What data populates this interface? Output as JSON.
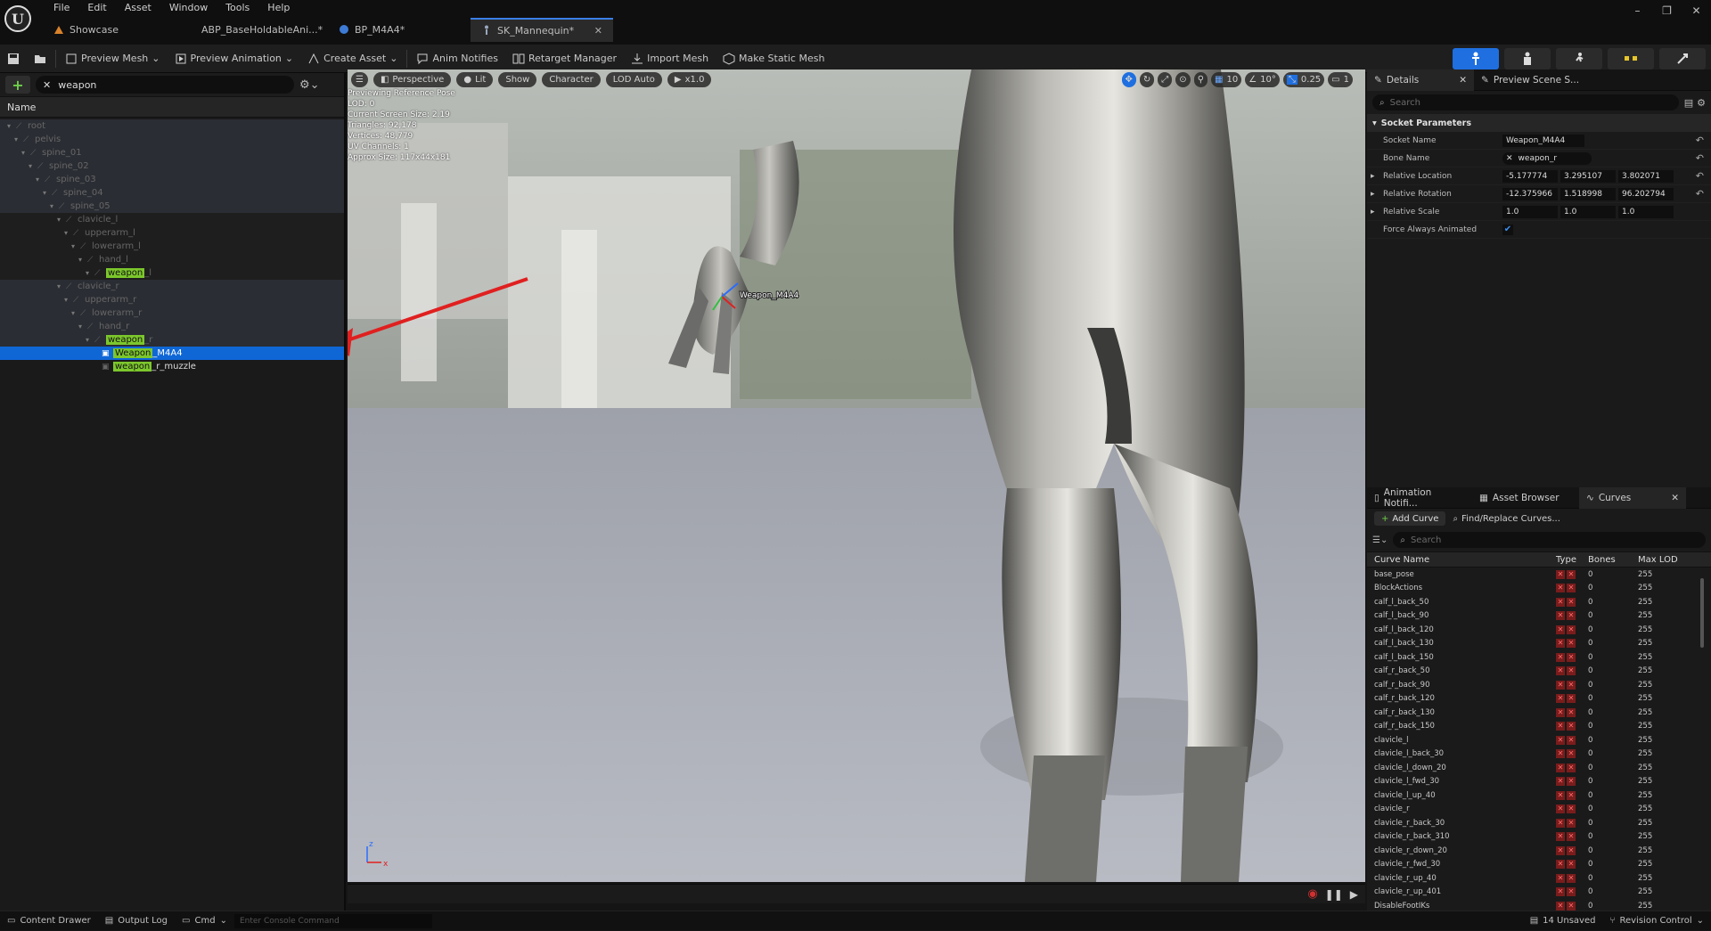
{
  "window": {
    "menu": [
      "File",
      "Edit",
      "Asset",
      "Window",
      "Tools",
      "Help"
    ],
    "tabs": [
      {
        "label": "Showcase",
        "icon": "level-icon"
      },
      {
        "label": "ABP_BaseHoldableAni...*",
        "icon": "anim-blueprint-icon"
      },
      {
        "label": "BP_M4A4*",
        "icon": "blueprint-icon"
      },
      {
        "label": "SK_Mannequin*",
        "icon": "skeleton-icon",
        "active": true
      }
    ]
  },
  "toolbar": {
    "preview_mesh": "Preview Mesh",
    "preview_animation": "Preview Animation",
    "create_asset": "Create Asset",
    "anim_notifies": "Anim Notifies",
    "retarget_manager": "Retarget Manager",
    "import_mesh": "Import Mesh",
    "make_static_mesh": "Make Static Mesh"
  },
  "skeleton_tree": {
    "search_value": "weapon",
    "column_name": "Name",
    "nodes": [
      {
        "label": "root",
        "depth": 0,
        "style": "dim"
      },
      {
        "label": "pelvis",
        "depth": 1,
        "style": "dim"
      },
      {
        "label": "spine_01",
        "depth": 2,
        "style": "dim"
      },
      {
        "label": "spine_02",
        "depth": 3,
        "style": "dim"
      },
      {
        "label": "spine_03",
        "depth": 4,
        "style": "dim"
      },
      {
        "label": "spine_04",
        "depth": 5,
        "style": "dim"
      },
      {
        "label": "spine_05",
        "depth": 6,
        "style": "dim"
      },
      {
        "label": "clavicle_l",
        "depth": 7,
        "style": "mid"
      },
      {
        "label": "upperarm_l",
        "depth": 8,
        "style": "mid"
      },
      {
        "label": "lowerarm_l",
        "depth": 9,
        "style": "mid"
      },
      {
        "label": "hand_l",
        "depth": 10,
        "style": "mid"
      },
      {
        "label": "weapon_l",
        "depth": 11,
        "style": "mid",
        "highlight": "weapon",
        "rest": "_l"
      },
      {
        "label": "clavicle_r",
        "depth": 7,
        "style": "dim"
      },
      {
        "label": "upperarm_r",
        "depth": 8,
        "style": "dim"
      },
      {
        "label": "lowerarm_r",
        "depth": 9,
        "style": "dim"
      },
      {
        "label": "hand_r",
        "depth": 10,
        "style": "dim"
      },
      {
        "label": "weapon_r",
        "depth": 11,
        "style": "dim",
        "highlight": "weapon",
        "rest": "_r"
      },
      {
        "label": "Weapon_M4A4",
        "depth": 12,
        "style": "sel",
        "socket": true,
        "highlight": "Weapon",
        "rest": "_M4A4"
      },
      {
        "label": "weapon_r_muzzle",
        "depth": 12,
        "style": "none",
        "socket": true,
        "highlight": "weapon",
        "rest": "_r_muzzle"
      }
    ]
  },
  "viewport": {
    "buttons": [
      "Perspective",
      "Lit",
      "Show",
      "Character",
      "LOD Auto",
      "x1.0"
    ],
    "right_values": [
      "10",
      "10°",
      "0.25",
      "1"
    ],
    "info": [
      "Previewing Reference Pose",
      "LOD: 0",
      "Current Screen Size: 2.19",
      "Triangles: 92,178",
      "Vertices: 48,779",
      "UV Channels: 1",
      "Approx Size: 117x44x181"
    ],
    "socket_label": "Weapon_M4A4",
    "axis_z": "z",
    "axis_x": "x"
  },
  "details": {
    "tab_details": "Details",
    "tab_preview": "Preview Scene S...",
    "search_placeholder": "Search",
    "category": "Socket Parameters",
    "socket_name_label": "Socket Name",
    "socket_name": "Weapon_M4A4",
    "bone_name_label": "Bone Name",
    "bone_name": "weapon_r",
    "loc_label": "Relative Location",
    "loc": [
      "-5.177774",
      "3.295107",
      "3.802071"
    ],
    "rot_label": "Relative Rotation",
    "rot": [
      "-12.375966",
      "1.518998",
      "96.202794"
    ],
    "scale_label": "Relative Scale",
    "scale": [
      "1.0",
      "1.0",
      "1.0"
    ],
    "force_label": "Force Always Animated"
  },
  "curves": {
    "tabs": [
      "Animation Notifi...",
      "Asset Browser",
      "Curves"
    ],
    "add_curve": "Add Curve",
    "find_replace": "Find/Replace Curves...",
    "search_placeholder": "Search",
    "columns": [
      "Curve Name",
      "Type",
      "Bones",
      "Max LOD"
    ],
    "rows": [
      [
        "base_pose",
        "0",
        "255"
      ],
      [
        "BlockActions",
        "0",
        "255"
      ],
      [
        "calf_l_back_50",
        "0",
        "255"
      ],
      [
        "calf_l_back_90",
        "0",
        "255"
      ],
      [
        "calf_l_back_120",
        "0",
        "255"
      ],
      [
        "calf_l_back_130",
        "0",
        "255"
      ],
      [
        "calf_l_back_150",
        "0",
        "255"
      ],
      [
        "calf_r_back_50",
        "0",
        "255"
      ],
      [
        "calf_r_back_90",
        "0",
        "255"
      ],
      [
        "calf_r_back_120",
        "0",
        "255"
      ],
      [
        "calf_r_back_130",
        "0",
        "255"
      ],
      [
        "calf_r_back_150",
        "0",
        "255"
      ],
      [
        "clavicle_l",
        "0",
        "255"
      ],
      [
        "clavicle_l_back_30",
        "0",
        "255"
      ],
      [
        "clavicle_l_down_20",
        "0",
        "255"
      ],
      [
        "clavicle_l_fwd_30",
        "0",
        "255"
      ],
      [
        "clavicle_l_up_40",
        "0",
        "255"
      ],
      [
        "clavicle_r",
        "0",
        "255"
      ],
      [
        "clavicle_r_back_30",
        "0",
        "255"
      ],
      [
        "clavicle_r_back_310",
        "0",
        "255"
      ],
      [
        "clavicle_r_down_20",
        "0",
        "255"
      ],
      [
        "clavicle_r_fwd_30",
        "0",
        "255"
      ],
      [
        "clavicle_r_up_40",
        "0",
        "255"
      ],
      [
        "clavicle_r_up_401",
        "0",
        "255"
      ],
      [
        "DisableFootIKs",
        "0",
        "255"
      ]
    ]
  },
  "statusbar": {
    "content_drawer": "Content Drawer",
    "output_log": "Output Log",
    "cmd": "Cmd",
    "console_placeholder": "Enter Console Command",
    "unsaved": "14 Unsaved",
    "revision": "Revision Control"
  },
  "colors": {
    "accent": "#1f6fe0",
    "selection": "#0f67d6",
    "highlight": "#7cc72c",
    "arrow": "#e02020"
  }
}
